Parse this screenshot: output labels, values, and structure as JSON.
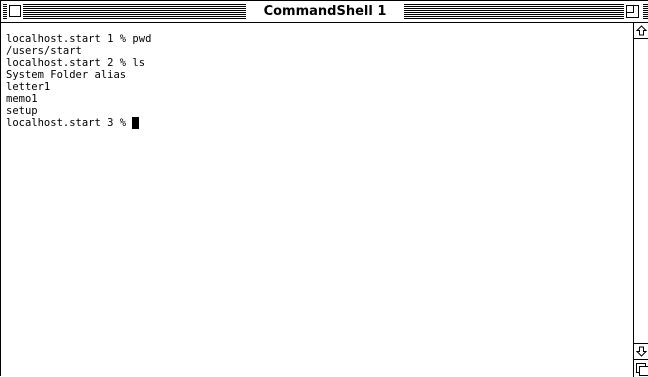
{
  "window": {
    "title": "CommandShell 1"
  },
  "terminal": {
    "lines": [
      "localhost.start 1 % pwd",
      "/users/start",
      "localhost.start 2 % ls",
      "System Folder alias",
      "letter1",
      "memo1",
      "setup"
    ],
    "prompt": "localhost.start 3 % "
  },
  "icons": {
    "close": "close-box-icon",
    "zoom": "zoom-box-icon",
    "scroll_up": "arrow-up-icon",
    "scroll_down": "arrow-down-icon",
    "grow": "size-box-icon"
  },
  "colors": {
    "foreground": "#000000",
    "background": "#ffffff"
  }
}
